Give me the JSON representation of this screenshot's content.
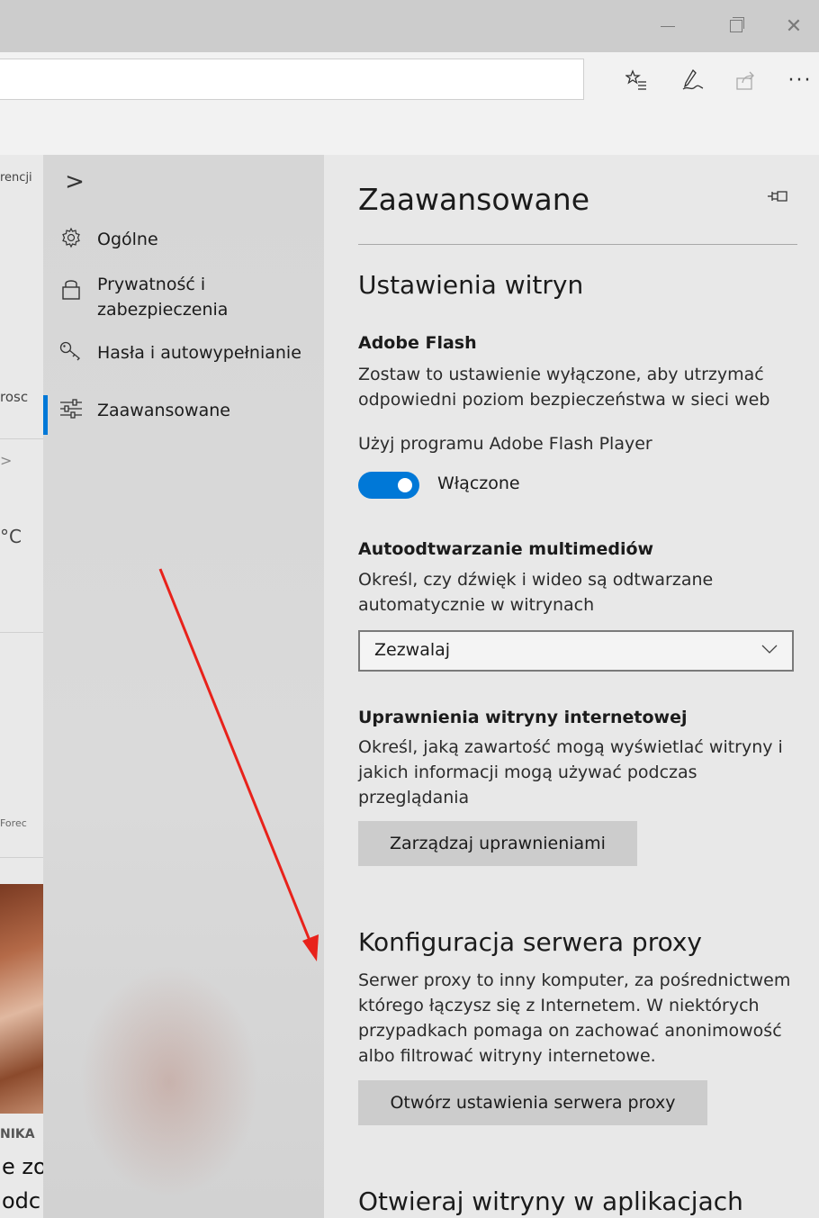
{
  "window": {
    "minimize_glyph": "—",
    "close_glyph": "✕"
  },
  "toolbar": {
    "favorites_icon": "favorites-list-icon",
    "pen_icon": "pen-icon",
    "share_icon": "share-icon",
    "more_glyph": "···"
  },
  "background_page": {
    "fragments": [
      "rencji",
      "rosc",
      ">",
      "°C",
      "Forec",
      "NIKA",
      "e zo",
      "odc"
    ]
  },
  "nav": {
    "expand_glyph": ">",
    "items": [
      {
        "label": "Ogólne",
        "icon": "gear-icon"
      },
      {
        "label": "Prywatność i zabezpieczenia",
        "icon": "lock-icon"
      },
      {
        "label": "Hasła i autowypełnianie",
        "icon": "key-icon"
      },
      {
        "label": "Zaawansowane",
        "icon": "sliders-icon"
      }
    ],
    "active_index": 3,
    "accent_color": "#0078d7"
  },
  "panel": {
    "title": "Zaawansowane",
    "pin_icon": "pin-icon",
    "site_settings": {
      "title": "Ustawienia witryn",
      "flash_heading": "Adobe Flash",
      "flash_desc": "Zostaw to ustawienie wyłączone, aby utrzymać odpowiedni poziom bezpieczeństwa w sieci web",
      "flash_toggle_label": "Użyj programu Adobe Flash Player",
      "flash_toggle_state": "Włączone",
      "autoplay_heading": "Autoodtwarzanie multimediów",
      "autoplay_desc": "Określ, czy dźwięk i wideo są odtwarzane automatycznie w witrynach",
      "autoplay_value": "Zezwalaj",
      "permissions_heading": "Uprawnienia witryny internetowej",
      "permissions_desc": "Określ, jaką zawartość mogą wyświetlać witryny i jakich informacji mogą używać podczas przeglądania",
      "permissions_button": "Zarządzaj uprawnieniami"
    },
    "proxy": {
      "title": "Konfiguracja serwera proxy",
      "desc": "Serwer proxy to inny komputer, za pośrednictwem którego łączysz się z Internetem. W niektórych przypadkach pomaga on zachować anonimowość albo filtrować witryny internetowe.",
      "button": "Otwórz ustawienia serwera proxy"
    },
    "apps": {
      "title": "Otwieraj witryny w aplikacjach"
    }
  },
  "annotation": {
    "arrow_color": "#e8221b"
  }
}
